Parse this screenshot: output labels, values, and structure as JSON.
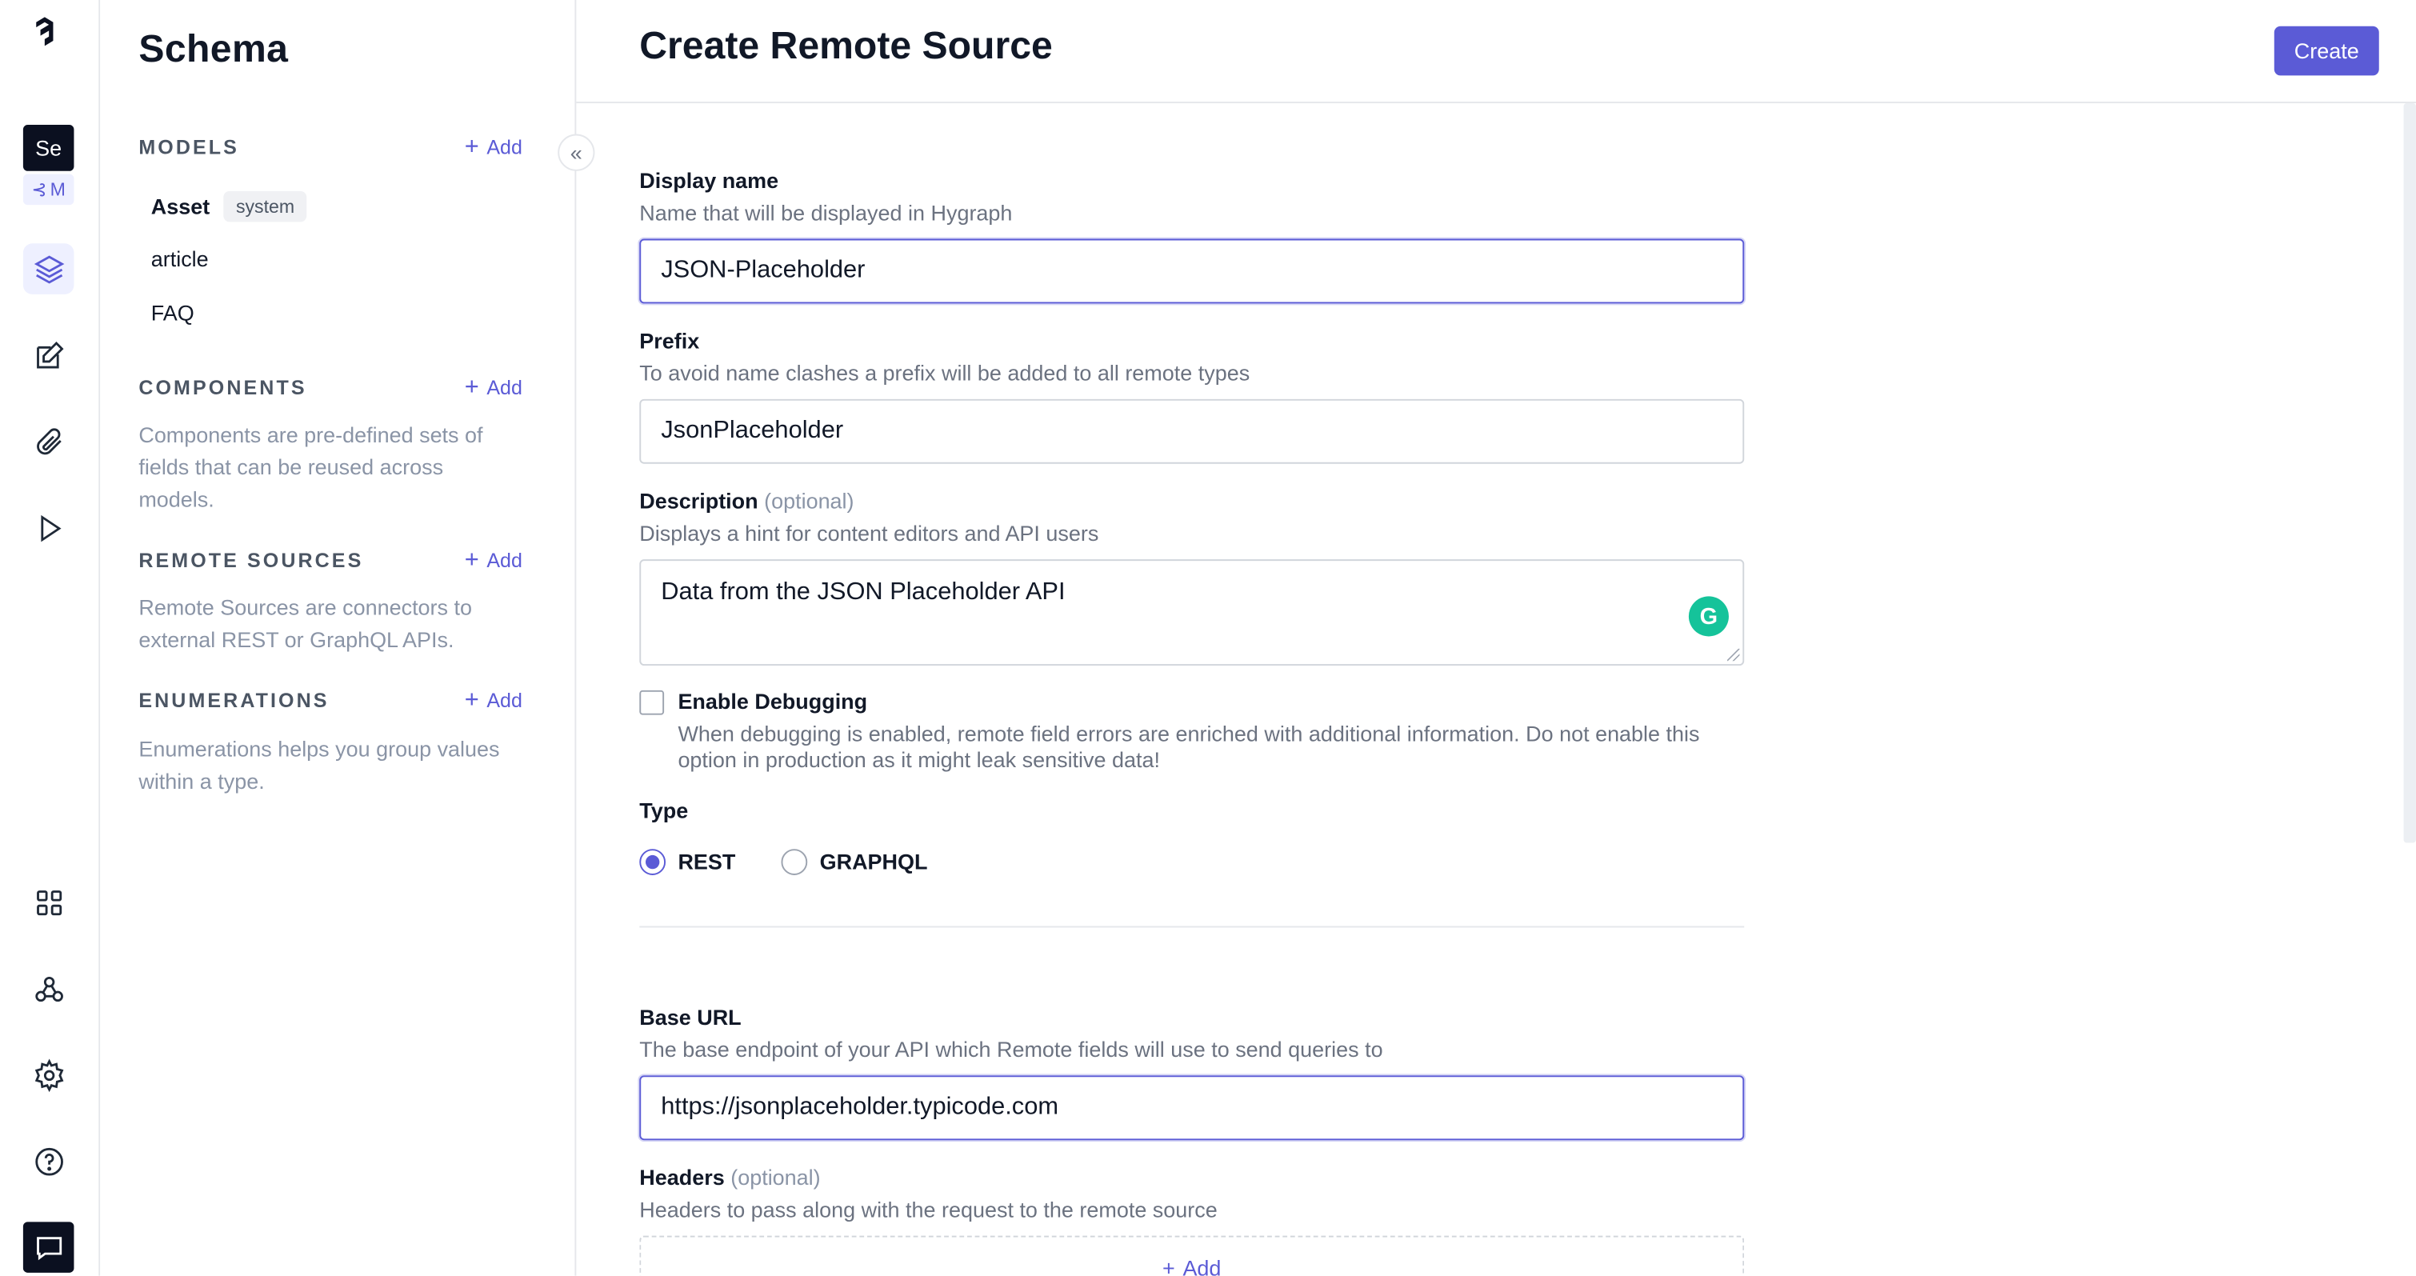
{
  "rail": {
    "project_abbr": "Se",
    "env_label": "M",
    "colors": {
      "accent": "#5b5bd6",
      "dark": "#0b1020"
    },
    "icons": [
      "hygraph-logo-icon",
      "schema-layers-icon",
      "edit-content-icon",
      "assets-paperclip-icon",
      "playground-play-icon",
      "apps-grid-icon",
      "webhooks-icon",
      "settings-gear-icon",
      "help-circle-icon",
      "chat-icon"
    ]
  },
  "sidebar": {
    "title": "Schema",
    "models": {
      "title": "MODELS",
      "add_label": "Add",
      "items": [
        {
          "name": "Asset",
          "badge": "system"
        },
        {
          "name": "article"
        },
        {
          "name": "FAQ"
        }
      ]
    },
    "components": {
      "title": "COMPONENTS",
      "add_label": "Add",
      "description": "Components are pre-defined sets of fields that can be reused across models."
    },
    "remote_sources": {
      "title": "REMOTE SOURCES",
      "add_label": "Add",
      "description": "Remote Sources are connectors to external REST or GraphQL APIs."
    },
    "enumerations": {
      "title": "ENUMERATIONS",
      "add_label": "Add",
      "description": "Enumerations helps you group values within a type."
    }
  },
  "main": {
    "title": "Create Remote Source",
    "create_label": "Create",
    "display_name": {
      "label": "Display name",
      "help": "Name that will be displayed in Hygraph",
      "value": "JSON-Placeholder"
    },
    "prefix": {
      "label": "Prefix",
      "help": "To avoid name clashes a prefix will be added to all remote types",
      "value": "JsonPlaceholder"
    },
    "description": {
      "label": "Description",
      "optional": "(optional)",
      "help": "Displays a hint for content editors and API users",
      "value": "Data from the JSON Placeholder API"
    },
    "debugging": {
      "label": "Enable Debugging",
      "checked": false,
      "help": "When debugging is enabled, remote field errors are enriched with additional information. Do not enable this option in production as it might leak sensitive data!"
    },
    "type": {
      "label": "Type",
      "options": [
        {
          "label": "REST",
          "checked": true
        },
        {
          "label": "GRAPHQL",
          "checked": false
        }
      ]
    },
    "base_url": {
      "label": "Base URL",
      "help": "The base endpoint of your API which Remote fields will use to send queries to",
      "value": "https://jsonplaceholder.typicode.com"
    },
    "headers": {
      "label": "Headers",
      "optional": "(optional)",
      "help": "Headers to pass along with the request to the remote source",
      "add_label": "Add"
    }
  }
}
